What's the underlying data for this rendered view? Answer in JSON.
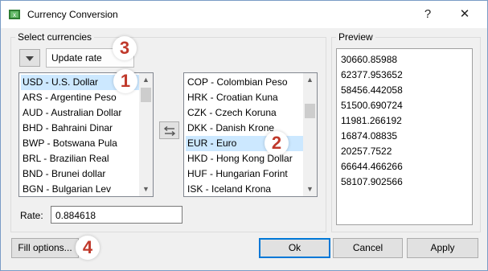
{
  "window": {
    "title": "Currency Conversion",
    "help_glyph": "?",
    "close_glyph": "✕"
  },
  "select_currencies": {
    "label": "Select currencies",
    "update_rate_label": "Update rate",
    "source_list": [
      "USD - U.S. Dollar",
      "ARS - Argentine Peso",
      "AUD - Australian Dollar",
      "BHD - Bahraini Dinar",
      "BWP - Botswana Pula",
      "BRL - Brazilian Real",
      "BND - Brunei dollar",
      "BGN - Bulgarian Lev"
    ],
    "source_selected": "USD - U.S. Dollar",
    "target_list": [
      "COP - Colombian Peso",
      "HRK - Croatian Kuna",
      "CZK - Czech Koruna",
      "DKK - Danish Krone",
      "EUR - Euro",
      "HKD - Hong Kong Dollar",
      "HUF - Hungarian Forint",
      "ISK - Iceland Krona"
    ],
    "target_selected": "EUR - Euro",
    "rate_label": "Rate:",
    "rate_value": "0.884618"
  },
  "preview": {
    "label": "Preview",
    "values": [
      "30660.85988",
      "62377.953652",
      "58456.442058",
      "51500.690724",
      "11981.266192",
      "16874.08835",
      "20257.7522",
      "66644.466266",
      "58107.902566"
    ]
  },
  "buttons": {
    "fill_options": "Fill options...",
    "ok": "Ok",
    "cancel": "Cancel",
    "apply": "Apply"
  },
  "annotations": {
    "step1": "1",
    "step2": "2",
    "step3": "3",
    "step4": "4",
    "color": "#c0392b"
  },
  "colors": {
    "selection": "#cce8ff",
    "accent": "#0078d7"
  }
}
